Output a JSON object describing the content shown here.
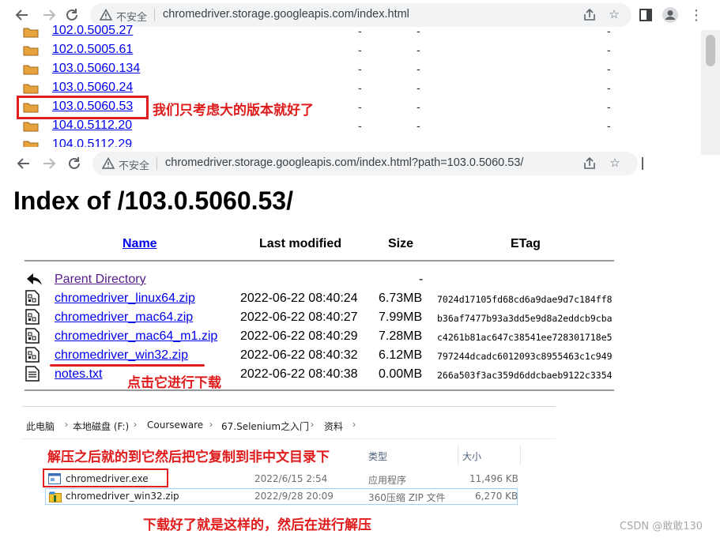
{
  "browser_top": {
    "insecure_label": "不安全",
    "url": "chromedriver.storage.googleapis.com/index.html"
  },
  "browser_second": {
    "insecure_label": "不安全",
    "url": "chromedriver.storage.googleapis.com/index.html?path=103.0.5060.53/"
  },
  "directory_list": {
    "items": [
      {
        "label": "102.0.5005.27",
        "modified": "-",
        "size": "-",
        "etag": "-"
      },
      {
        "label": "102.0.5005.61",
        "modified": "-",
        "size": "-",
        "etag": "-"
      },
      {
        "label": "103.0.5060.134",
        "modified": "-",
        "size": "-",
        "etag": "-"
      },
      {
        "label": "103.0.5060.24",
        "modified": "-",
        "size": "-",
        "etag": "-"
      },
      {
        "label": "103.0.5060.53",
        "modified": "-",
        "size": "-",
        "etag": "-"
      },
      {
        "label": "104.0.5112.20",
        "modified": "-",
        "size": "-",
        "etag": "-"
      },
      {
        "label": "104.0.5112.29",
        "modified": "",
        "size": "",
        "etag": ""
      }
    ]
  },
  "annotations": {
    "note_version": "我们只考虑大的版本就好了",
    "note_click": "点击它进行下载",
    "note_unzip": "解压之后就的到它然后把它复制到非中文目录下",
    "note_done": "下载好了就是这样的，然后在进行解压"
  },
  "index_page": {
    "title": "Index of /103.0.5060.53/",
    "columns": {
      "name": "Name",
      "last_modified": "Last modified",
      "size": "Size",
      "etag": "ETag"
    },
    "parent": {
      "label": "Parent Directory",
      "size": "-"
    },
    "files": [
      {
        "name": "chromedriver_linux64.zip",
        "modified": "2022-06-22 08:40:24",
        "size": "6.73MB",
        "etag": "7024d17105fd68cd6a9dae9d7c184ff8"
      },
      {
        "name": "chromedriver_mac64.zip",
        "modified": "2022-06-22 08:40:27",
        "size": "7.99MB",
        "etag": "b36af7477b93a3dd5e9d8a2eddcb9cba"
      },
      {
        "name": "chromedriver_mac64_m1.zip",
        "modified": "2022-06-22 08:40:29",
        "size": "7.28MB",
        "etag": "c4261b81ac647c38541ee728301718e5"
      },
      {
        "name": "chromedriver_win32.zip",
        "modified": "2022-06-22 08:40:32",
        "size": "6.12MB",
        "etag": "797244dcadc6012093c8955463c1c949"
      },
      {
        "name": "notes.txt",
        "modified": "2022-06-22 08:40:38",
        "size": "0.00MB",
        "etag": "266a503f3ac359d6ddcbaeb9122c3354"
      }
    ]
  },
  "explorer": {
    "breadcrumb": [
      "此电脑",
      "本地磁盘 (F:)",
      "Courseware",
      "67.Selenium之入门",
      "资料"
    ],
    "columns": {
      "type": "类型",
      "size": "大小"
    },
    "rows": [
      {
        "name": "chromedriver.exe",
        "date": "2022/6/15 2:54",
        "type": "应用程序",
        "size": "11,496 KB"
      },
      {
        "name": "chromedriver_win32.zip",
        "date": "2022/9/28 20:09",
        "type": "360压缩 ZIP 文件",
        "size": "6,270 KB"
      }
    ]
  },
  "watermark": "CSDN @敢敢130",
  "colors": {
    "annotation_red": "#e02020",
    "link_blue": "#0000ee",
    "visited_purple": "#551a8b"
  }
}
